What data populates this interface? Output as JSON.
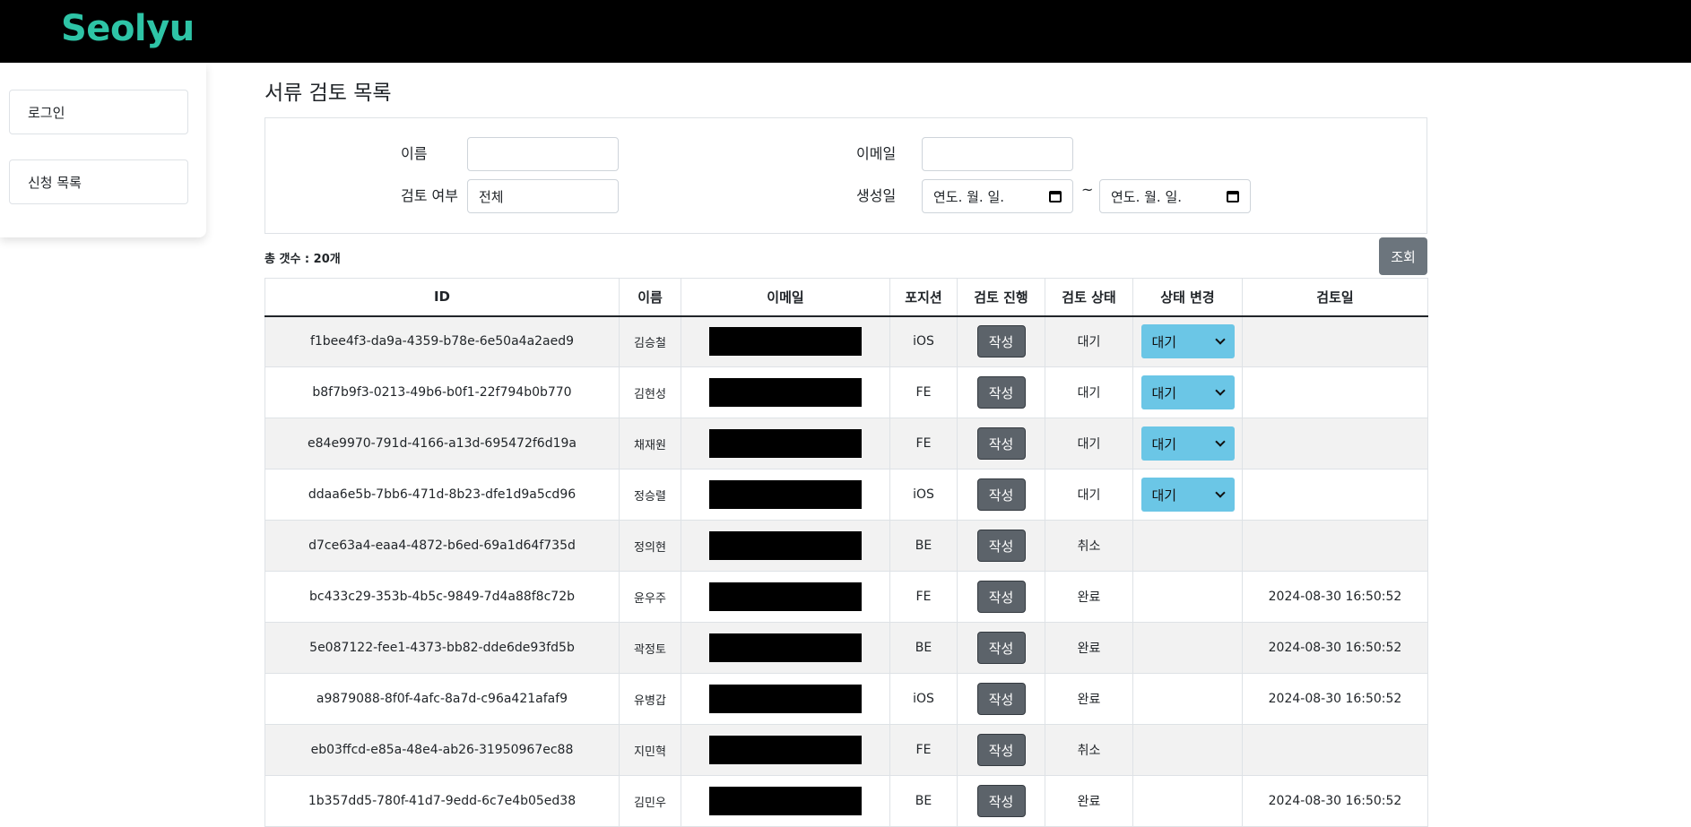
{
  "header": {
    "brand": "Seolyu",
    "brand_color": "#2ec4a6"
  },
  "sidebar": {
    "items": [
      {
        "label": "로그인"
      },
      {
        "label": "신청 목록"
      }
    ]
  },
  "page": {
    "title": "서류 검토 목록"
  },
  "filters": {
    "name_label": "이름",
    "name_value": "",
    "email_label": "이메일",
    "email_value": "",
    "review_label": "검토 여부",
    "review_value": "전체",
    "created_label": "생성일",
    "date_from": "연도. 월. 일.",
    "date_to": "연도. 월. 일.",
    "range_sep": "~"
  },
  "summary": {
    "total": "총 갯수 : 20개"
  },
  "search_button": "조회",
  "table": {
    "columns": [
      "ID",
      "이름",
      "이메일",
      "포지션",
      "검토 진행",
      "검토 상태",
      "상태 변경",
      "검토일"
    ],
    "write_label": "작성",
    "rows": [
      {
        "id": "f1bee4f3-da9a-4359-b78e-6e50a4a2aed9",
        "name": "김승철",
        "position": "iOS",
        "status": "대기",
        "change": "대기",
        "date": ""
      },
      {
        "id": "b8f7b9f3-0213-49b6-b0f1-22f794b0b770",
        "name": "김현성",
        "position": "FE",
        "status": "대기",
        "change": "대기",
        "date": ""
      },
      {
        "id": "e84e9970-791d-4166-a13d-695472f6d19a",
        "name": "채재원",
        "position": "FE",
        "status": "대기",
        "change": "대기",
        "date": ""
      },
      {
        "id": "ddaa6e5b-7bb6-471d-8b23-dfe1d9a5cd96",
        "name": "정승렬",
        "position": "iOS",
        "status": "대기",
        "change": "대기",
        "date": ""
      },
      {
        "id": "d7ce63a4-eaa4-4872-b6ed-69a1d64f735d",
        "name": "정의현",
        "position": "BE",
        "status": "취소",
        "change": "",
        "date": ""
      },
      {
        "id": "bc433c29-353b-4b5c-9849-7d4a88f8c72b",
        "name": "윤우주",
        "position": "FE",
        "status": "완료",
        "change": "",
        "date": "2024-08-30 16:50:52"
      },
      {
        "id": "5e087122-fee1-4373-bb82-dde6de93fd5b",
        "name": "곽정토",
        "position": "BE",
        "status": "완료",
        "change": "",
        "date": "2024-08-30 16:50:52"
      },
      {
        "id": "a9879088-8f0f-4afc-8a7d-c96a421afaf9",
        "name": "유병갑",
        "position": "iOS",
        "status": "완료",
        "change": "",
        "date": "2024-08-30 16:50:52"
      },
      {
        "id": "eb03ffcd-e85a-48e4-ab26-31950967ec88",
        "name": "지민혁",
        "position": "FE",
        "status": "취소",
        "change": "",
        "date": ""
      },
      {
        "id": "1b357dd5-780f-41d7-9edd-6c7e4b05ed38",
        "name": "김민우",
        "position": "BE",
        "status": "완료",
        "change": "",
        "date": "2024-08-30 16:50:52"
      }
    ]
  }
}
